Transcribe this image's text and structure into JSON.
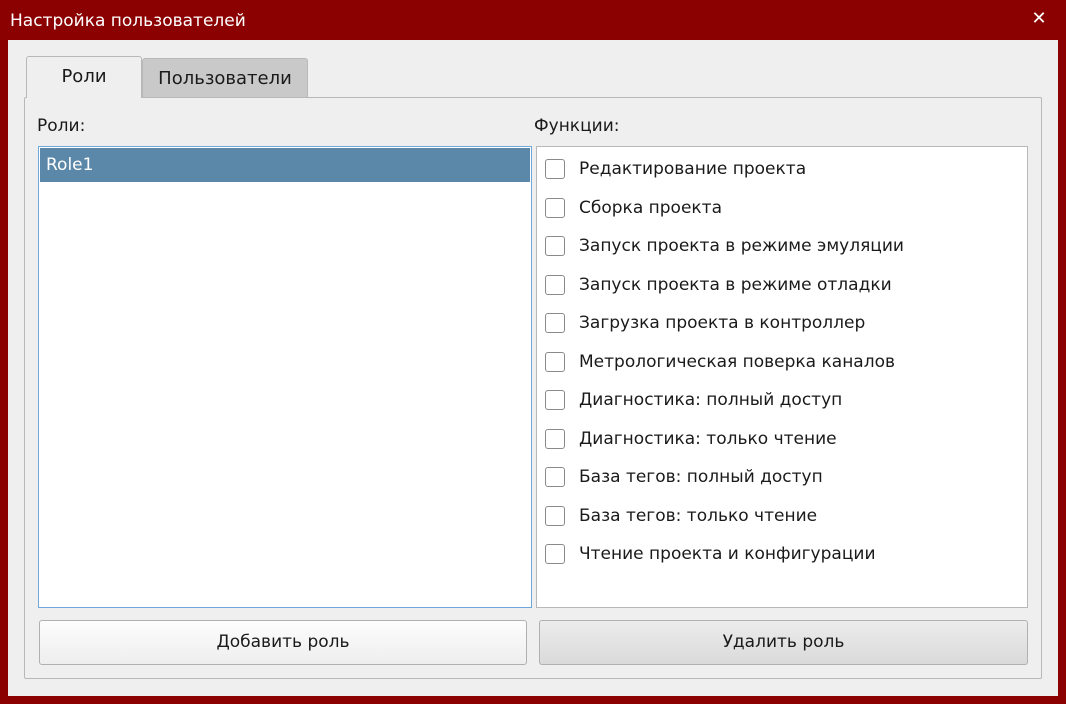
{
  "window": {
    "title": "Настройка пользователей",
    "close_glyph": "✕"
  },
  "tabs": [
    {
      "label": "Роли",
      "active": true
    },
    {
      "label": "Пользователи",
      "active": false
    }
  ],
  "roles": {
    "label": "Роли:",
    "items": [
      {
        "label": "Role1",
        "selected": true
      }
    ]
  },
  "functions": {
    "label": "Функции:",
    "items": [
      {
        "label": "Редактирование проекта",
        "checked": false
      },
      {
        "label": "Сборка проекта",
        "checked": false
      },
      {
        "label": "Запуск проекта в режиме эмуляции",
        "checked": false
      },
      {
        "label": "Запуск проекта в режиме отладки",
        "checked": false
      },
      {
        "label": "Загрузка проекта в контроллер",
        "checked": false
      },
      {
        "label": "Метрологическая поверка каналов",
        "checked": false
      },
      {
        "label": "Диагностика: полный доступ",
        "checked": false
      },
      {
        "label": "Диагностика: только чтение",
        "checked": false
      },
      {
        "label": "База тегов: полный доступ",
        "checked": false
      },
      {
        "label": "База тегов: только чтение",
        "checked": false
      },
      {
        "label": "Чтение проекта и конфигурации",
        "checked": false
      }
    ]
  },
  "buttons": {
    "add_role": "Добавить роль",
    "delete_role": "Удалить роль"
  },
  "colors": {
    "titlebar": "#8b0000",
    "selection": "#5b87a8",
    "list_focus_border": "#6fa7d8"
  }
}
